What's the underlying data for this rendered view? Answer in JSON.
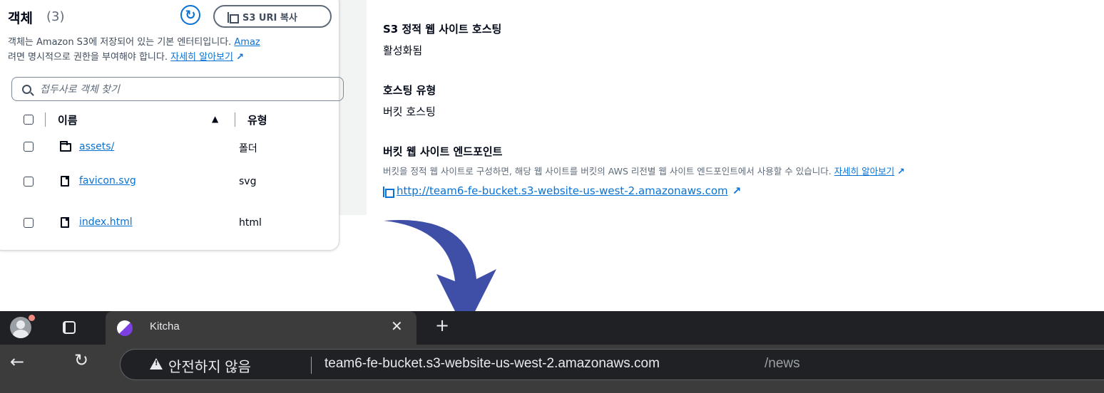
{
  "objects_panel": {
    "title": "객체",
    "count": "(3)",
    "copy_uri_label": "S3 URI 복사",
    "description_line1_prefix": "객체는 Amazon S3에 저장되어 있는 기본 엔터티입니다. ",
    "description_link1": "Amaz",
    "description_line2_prefix": "려면 명시적으로 권한을 부여해야 합니다. ",
    "learn_more": "자세히 알아보기",
    "search_placeholder": "접두사로 객체 찾기",
    "columns": {
      "name": "이름",
      "type": "유형"
    },
    "rows": [
      {
        "name": "assets/",
        "type": "폴더",
        "icon": "folder-icon"
      },
      {
        "name": "favicon.svg",
        "type": "svg",
        "icon": "file-icon"
      },
      {
        "name": "index.html",
        "type": "html",
        "icon": "file-icon"
      }
    ]
  },
  "hosting_panel": {
    "static_hosting_label": "S3 정적 웹 사이트 호스팅",
    "static_hosting_value": "활성화됨",
    "hosting_type_label": "호스팅 유형",
    "hosting_type_value": "버킷 호스팅",
    "endpoint_label": "버킷 웹 사이트 엔드포인트",
    "endpoint_description": "버킷을 정적 웹 사이트로 구성하면, 해당 웹 사이트를 버킷의 AWS 리전별 웹 사이트 엔드포인트에서 사용할 수 있습니다.",
    "learn_more": "자세히 알아보기",
    "endpoint_url": "http://team6-fe-bucket.s3-website-us-west-2.amazonaws.com"
  },
  "browser": {
    "tab_title": "Kitcha",
    "security_label": "안전하지 않음",
    "url_host": "team6-fe-bucket.s3-website-us-west-2.amazonaws.com",
    "url_path": "/news"
  },
  "colors": {
    "link": "#0972d3",
    "arrow": "#3f4ea6",
    "browser_dark": "#202124"
  }
}
